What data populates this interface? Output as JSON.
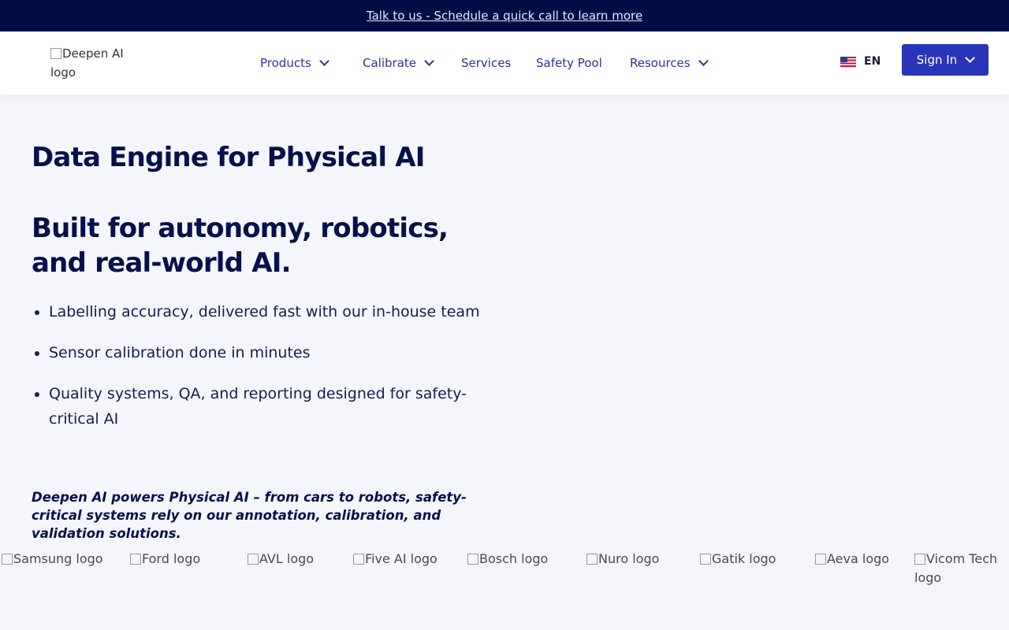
{
  "announcement": {
    "text": "Talk to us - Schedule a quick call to learn more"
  },
  "header": {
    "logo_alt": "Deepen AI logo",
    "nav": {
      "products": "Products",
      "calibrate": "Calibrate",
      "services": "Services",
      "safety_pool": "Safety Pool",
      "resources": "Resources"
    },
    "language": "EN",
    "signin": "Sign In"
  },
  "hero": {
    "title": "Data Engine for Physical AI",
    "subtitle": "Built for autonomy, robotics, and real-world AI.",
    "bullets": [
      "Labelling accuracy, delivered fast with our in-house team",
      "Sensor calibration done in minutes",
      "Quality systems, QA, and reporting designed for safety-critical AI"
    ],
    "tagline": "Deepen AI powers Physical AI – from cars to robots, safety-critical systems rely on our annotation, calibration, and validation solutions."
  },
  "client_logos": [
    "Samsung logo",
    "Ford logo",
    "AVL logo",
    "Five AI logo",
    "Bosch logo",
    "Nuro logo",
    "Gatik logo",
    "Aeva logo",
    "Vicom Tech logo"
  ],
  "colors": {
    "announcement_bg": "#030d45",
    "signin_bg": "#2a34b8",
    "page_bg": "#f4f6fb",
    "heading": "#07104a",
    "nav_link": "#2a3690"
  }
}
